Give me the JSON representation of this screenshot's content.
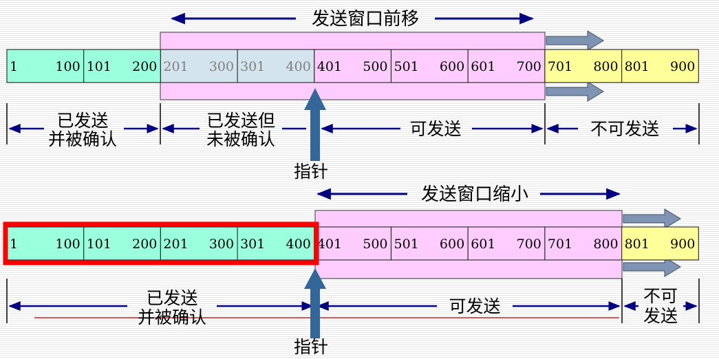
{
  "top": {
    "window_title": "发送窗口前移",
    "cells": [
      {
        "start": "1",
        "end": "100",
        "fill": "#99ffdd",
        "text_color": "#000000"
      },
      {
        "start": "101",
        "end": "200",
        "fill": "#99ffdd",
        "text_color": "#000000"
      },
      {
        "start": "201",
        "end": "300",
        "fill": "#d4e4ee",
        "text_color": "#7f7f7f"
      },
      {
        "start": "301",
        "end": "400",
        "fill": "#d4e4ee",
        "text_color": "#7f7f7f"
      },
      {
        "start": "401",
        "end": "500",
        "fill": "#ffccff",
        "text_color": "#000000"
      },
      {
        "start": "501",
        "end": "600",
        "fill": "#ffccff",
        "text_color": "#000000"
      },
      {
        "start": "601",
        "end": "700",
        "fill": "#ffccff",
        "text_color": "#000000"
      },
      {
        "start": "701",
        "end": "800",
        "fill": "#ffff99",
        "text_color": "#000000"
      },
      {
        "start": "801",
        "end": "900",
        "fill": "#ffff99",
        "text_color": "#000000"
      }
    ],
    "regions": [
      {
        "line1": "已发送",
        "line2": "并被确认"
      },
      {
        "line1": "已发送但",
        "line2": "未被确认"
      },
      {
        "line1": "可发送",
        "line2": ""
      },
      {
        "line1": "不可发送",
        "line2": ""
      }
    ],
    "pointer_label": "指针"
  },
  "bottom": {
    "window_title": "发送窗口缩小",
    "cells": [
      {
        "start": "1",
        "end": "100",
        "fill": "#99ffdd",
        "text_color": "#000000"
      },
      {
        "start": "101",
        "end": "200",
        "fill": "#99ffdd",
        "text_color": "#000000"
      },
      {
        "start": "201",
        "end": "300",
        "fill": "#99ffdd",
        "text_color": "#000000"
      },
      {
        "start": "301",
        "end": "400",
        "fill": "#99ffdd",
        "text_color": "#000000"
      },
      {
        "start": "401",
        "end": "500",
        "fill": "#ffccff",
        "text_color": "#000000"
      },
      {
        "start": "501",
        "end": "600",
        "fill": "#ffccff",
        "text_color": "#000000"
      },
      {
        "start": "601",
        "end": "700",
        "fill": "#ffccff",
        "text_color": "#000000"
      },
      {
        "start": "701",
        "end": "800",
        "fill": "#ffccff",
        "text_color": "#000000"
      },
      {
        "start": "801",
        "end": "900",
        "fill": "#ffff99",
        "text_color": "#000000"
      }
    ],
    "regions": [
      {
        "line1": "已发送",
        "line2": "并被确认"
      },
      {
        "line1": "可发送",
        "line2": ""
      },
      {
        "line1": "不可",
        "line2": "发送"
      }
    ],
    "pointer_label": "指针"
  },
  "colors": {
    "acked": "#99ffdd",
    "sent_unacked": "#d4e4ee",
    "window": "#ffccff",
    "not_sendable": "#ffff99",
    "pointer": "#336699",
    "slide_arrow": "#7f93b3",
    "highlight": "#ff0000",
    "span_arrow": "#000080"
  }
}
